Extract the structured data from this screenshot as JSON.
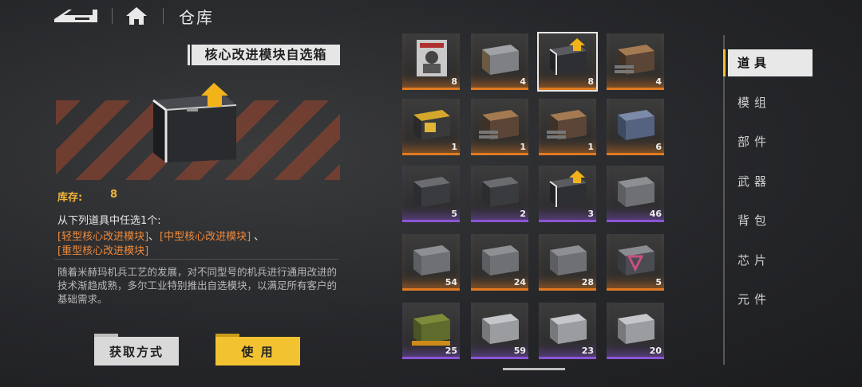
{
  "header": {
    "title": "仓库"
  },
  "item": {
    "name": "核心改进模块自选箱",
    "stock_label": "库存:",
    "stock_value": "8",
    "choose_text": "从下列道具中任选1个:",
    "options": [
      "[轻型核心改进模块]",
      "[中型核心改进模块]",
      "[重型核心改进模块]"
    ],
    "option_sep": "、",
    "description": "随着米赫玛机兵工艺的发展，对不同型号的机兵进行通用改进的技术渐趋成熟，多尔工业特别推出自选模块，以满足所有客户的基础需求。"
  },
  "buttons": {
    "get": "获取方式",
    "use": "使 用"
  },
  "grid": [
    {
      "icon": "magazine-icon",
      "count": "8",
      "rarity": "orange"
    },
    {
      "icon": "steel-crate-icon",
      "count": "4",
      "rarity": "orange"
    },
    {
      "icon": "core-module-selector-box-icon",
      "count": "8",
      "rarity": "orange"
    },
    {
      "icon": "gatling-module-icon",
      "count": "4",
      "rarity": "orange"
    },
    {
      "icon": "gold-chest-icon",
      "count": "1",
      "rarity": "orange"
    },
    {
      "icon": "gatling-module-icon",
      "count": "1",
      "rarity": "orange"
    },
    {
      "icon": "gatling-module-icon",
      "count": "1",
      "rarity": "orange"
    },
    {
      "icon": "blue-cube-box-icon",
      "count": "6",
      "rarity": "orange"
    },
    {
      "icon": "dark-module-box-icon",
      "count": "5",
      "rarity": "purple"
    },
    {
      "icon": "dark-module-box-icon",
      "count": "2",
      "rarity": "purple"
    },
    {
      "icon": "module-selector-box-icon",
      "count": "3",
      "rarity": "purple"
    },
    {
      "icon": "armored-crate-icon",
      "count": "46",
      "rarity": "purple"
    },
    {
      "icon": "armored-crate-icon",
      "count": "54",
      "rarity": "orange"
    },
    {
      "icon": "armored-crate-icon",
      "count": "24",
      "rarity": "orange"
    },
    {
      "icon": "armored-crate-icon",
      "count": "28",
      "rarity": "orange"
    },
    {
      "icon": "emblem-box-icon",
      "count": "5",
      "rarity": "orange"
    },
    {
      "icon": "green-supply-crate-icon",
      "count": "25",
      "rarity": "purple"
    },
    {
      "icon": "silver-crate-icon",
      "count": "59",
      "rarity": "purple"
    },
    {
      "icon": "silver-crate-icon",
      "count": "23",
      "rarity": "purple"
    },
    {
      "icon": "silver-crate-icon",
      "count": "20",
      "rarity": "purple"
    }
  ],
  "tabs": [
    "道具",
    "模组",
    "部件",
    "武器",
    "背包",
    "芯片",
    "元件"
  ],
  "active_tab": "道具"
}
